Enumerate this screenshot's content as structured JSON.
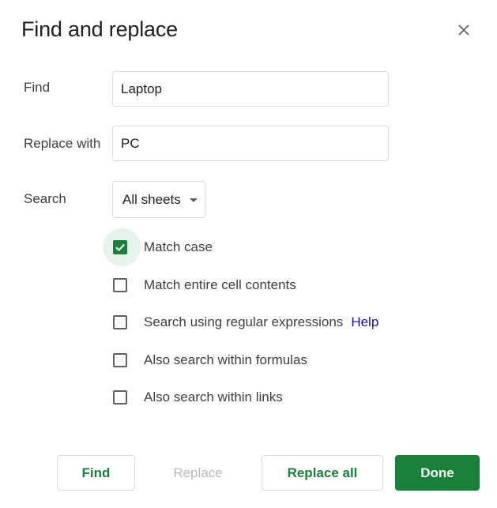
{
  "dialog": {
    "title": "Find and replace",
    "close_icon": "close-icon"
  },
  "find": {
    "label": "Find",
    "value": "Laptop"
  },
  "replace": {
    "label": "Replace with",
    "value": "PC"
  },
  "search": {
    "label": "Search",
    "selected": "All sheets",
    "icon": "chevron-down-icon"
  },
  "options": [
    {
      "label": "Match case",
      "checked": true
    },
    {
      "label": "Match entire cell contents",
      "checked": false
    },
    {
      "label": "Search using regular expressions",
      "checked": false,
      "link": "Help"
    },
    {
      "label": "Also search within formulas",
      "checked": false
    },
    {
      "label": "Also search within links",
      "checked": false
    }
  ],
  "buttons": {
    "find": "Find",
    "replace": "Replace",
    "replace_all": "Replace all",
    "done": "Done"
  },
  "colors": {
    "accent": "#188038",
    "link": "#1a0dab",
    "border": "#dadce0"
  }
}
